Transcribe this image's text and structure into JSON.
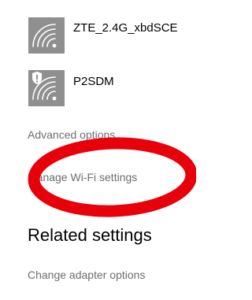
{
  "networks": [
    {
      "name": "ZTE_2.4G_xbdSCE",
      "secured": false,
      "icon": "wifi-signal-icon"
    },
    {
      "name": "P2SDM",
      "secured": true,
      "icon": "wifi-signal-shield-icon"
    }
  ],
  "links": {
    "advanced_options": "Advanced options",
    "manage_wifi": "Manage Wi-Fi settings"
  },
  "related_settings": {
    "heading": "Related settings",
    "change_adapter": "Change adapter options"
  },
  "annotation_color": "#e8000b"
}
